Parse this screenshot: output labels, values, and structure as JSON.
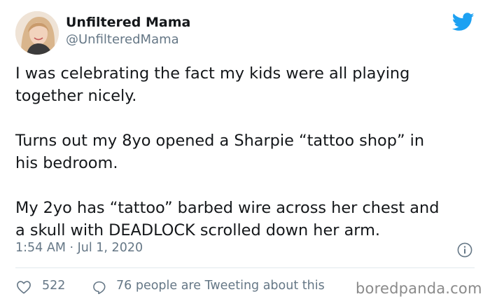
{
  "author": {
    "display_name": "Unfiltered Mama",
    "handle": "@UnfilteredMama"
  },
  "tweet": {
    "paragraphs": [
      "I was celebrating the fact my kids were all playing\ntogether nicely.",
      "Turns out my 8yo opened a Sharpie “tattoo shop” in\nhis bedroom.",
      "My 2yo has “tattoo” barbed wire across her chest and\na skull with DEADLOCK scrolled down her arm."
    ],
    "timestamp": "1:54 AM · Jul 1, 2020"
  },
  "engagement": {
    "likes": "522",
    "conversation": "76 people are Tweeting about this"
  },
  "watermark": "boredpanda.com",
  "icons": {
    "brand": "twitter-bird-icon",
    "info": "info-icon",
    "like": "heart-icon",
    "reply": "speech-bubble-icon"
  },
  "colors": {
    "twitter_blue": "#1da1f2",
    "secondary_text": "#657786",
    "primary_text": "#14171a",
    "divider": "#e1e8ed"
  }
}
